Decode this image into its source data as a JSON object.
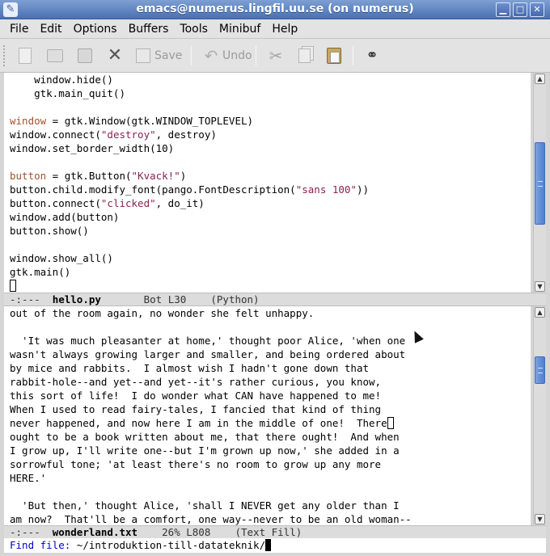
{
  "window": {
    "title": "emacs@numerus.lingfil.uu.se (on numerus)",
    "icon": "emacs-icon",
    "minimize_glyph": "▁",
    "maximize_glyph": "□",
    "close_glyph": "✕"
  },
  "menubar": {
    "items": [
      "File",
      "Edit",
      "Options",
      "Buffers",
      "Tools",
      "Minibuf",
      "Help"
    ]
  },
  "toolbar": {
    "save_label": "Save",
    "undo_label": "Undo",
    "icons": [
      "new-file-icon",
      "open-folder-icon",
      "dired-icon",
      "close-buffer-icon",
      "save-icon",
      "undo-icon",
      "cut-icon",
      "copy-icon",
      "paste-icon",
      "search-binoculars-icon"
    ]
  },
  "upper_buffer": {
    "lines": [
      [
        {
          "t": "    window.hide()"
        }
      ],
      [
        {
          "t": "    gtk.main_quit()"
        }
      ],
      [
        {
          "t": ""
        }
      ],
      [
        {
          "t": "window",
          "c": "kw"
        },
        {
          "t": " = gtk.Window(gtk.WINDOW_TOPLEVEL)"
        }
      ],
      [
        {
          "t": "window.connect("
        },
        {
          "t": "\"destroy\"",
          "c": "str"
        },
        {
          "t": ", destroy)"
        }
      ],
      [
        {
          "t": "window.set_border_width(10)"
        }
      ],
      [
        {
          "t": ""
        }
      ],
      [
        {
          "t": "button",
          "c": "kw"
        },
        {
          "t": " = gtk.Button("
        },
        {
          "t": "\"Kvack!\"",
          "c": "str"
        },
        {
          "t": ")"
        }
      ],
      [
        {
          "t": "button.child.modify_font(pango.FontDescription("
        },
        {
          "t": "\"sans 100\"",
          "c": "str"
        },
        {
          "t": "))"
        }
      ],
      [
        {
          "t": "button.connect("
        },
        {
          "t": "\"clicked\"",
          "c": "str"
        },
        {
          "t": ", do_it)"
        }
      ],
      [
        {
          "t": "window.add(button)"
        }
      ],
      [
        {
          "t": "button.show()"
        }
      ],
      [
        {
          "t": ""
        }
      ],
      [
        {
          "t": "window.show_all()"
        }
      ],
      [
        {
          "t": "gtk.main()"
        }
      ]
    ],
    "modeline": {
      "status": "-:---  ",
      "buffer": "hello.py",
      "position": "       Bot L30    ",
      "mode": "(Python)"
    }
  },
  "lower_buffer": {
    "lines": [
      "out of the room again, no wonder she felt unhappy.",
      "",
      "  'It was much pleasanter at home,' thought poor Alice, 'when one",
      "wasn't always growing larger and smaller, and being ordered about",
      "by mice and rabbits.  I almost wish I hadn't gone down that",
      "rabbit-hole--and yet--and yet--it's rather curious, you know,",
      "this sort of life!  I do wonder what CAN have happened to me!",
      "When I used to read fairy-tales, I fancied that kind of thing",
      "never happened, and now here I am in the middle of one!  There",
      "ought to be a book written about me, that there ought!  And when",
      "I grow up, I'll write one--but I'm grown up now,' she added in a",
      "sorrowful tone; 'at least there's no room to grow up any more",
      "HERE.'",
      "",
      "  'But then,' thought Alice, 'shall I NEVER get any older than I",
      "am now?  That'll be a comfort, one way--never to be an old woman--"
    ],
    "modeline": {
      "status": "-:---  ",
      "buffer": "wonderland.txt",
      "position": "    26% L808    ",
      "mode": "(Text Fill)"
    }
  },
  "minibuffer": {
    "prompt": "Find file: ",
    "value": "~/introduktion-till-datateknik/"
  }
}
